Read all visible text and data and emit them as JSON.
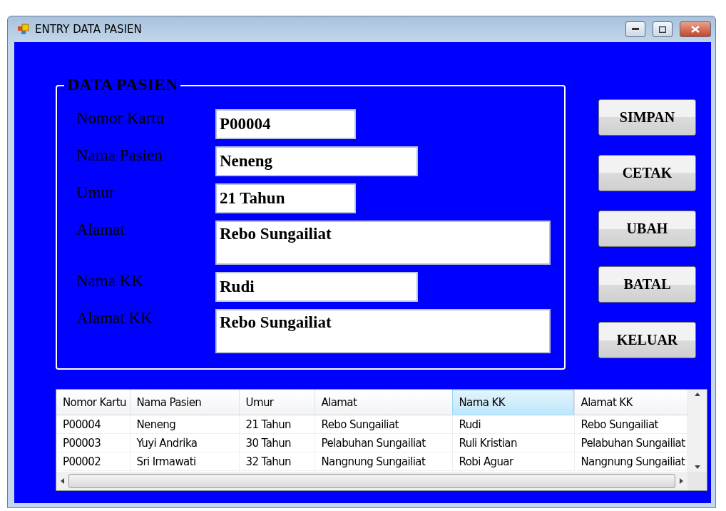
{
  "window": {
    "title": "ENTRY DATA PASIEN"
  },
  "form": {
    "title": "DATA PASIEN",
    "fields": [
      {
        "label": "Nomor Kartu",
        "value": "P00004",
        "kind": "short"
      },
      {
        "label": "Nama Pasien",
        "value": "Neneng",
        "kind": "medium"
      },
      {
        "label": "Umur",
        "value": "21 Tahun",
        "kind": "short"
      },
      {
        "label": "Alamat",
        "value": "Rebo Sungailiat",
        "kind": "multiline"
      },
      {
        "label": "Nama KK",
        "value": "Rudi",
        "kind": "medium"
      },
      {
        "label": "Alamat KK",
        "value": "Rebo Sungailiat",
        "kind": "multiline"
      }
    ]
  },
  "buttons": [
    "SIMPAN",
    "CETAK",
    "UBAH",
    "BATAL",
    "KELUAR"
  ],
  "table": {
    "columns": [
      {
        "label": "Nomor Kartu",
        "highlighted": false
      },
      {
        "label": "Nama Pasien",
        "highlighted": false
      },
      {
        "label": "Umur",
        "highlighted": false
      },
      {
        "label": "Alamat",
        "highlighted": false
      },
      {
        "label": "Nama KK",
        "highlighted": true
      },
      {
        "label": "Alamat KK",
        "highlighted": false
      }
    ],
    "rows": [
      [
        "P00004",
        "Neneng",
        "21  Tahun",
        "Rebo Sungailiat",
        "Rudi",
        "Rebo Sungailiat"
      ],
      [
        "P00003",
        "Yuyi Andrika",
        "30 Tahun",
        "Pelabuhan Sungailiat",
        "Ruli Kristian",
        "Pelabuhan Sungailiat"
      ],
      [
        "P00002",
        "Sri Irmawati",
        "32 Tahun",
        "Nangnung Sungailiat",
        "Robi Aguar",
        "Nangnung Sungailiat"
      ]
    ]
  }
}
